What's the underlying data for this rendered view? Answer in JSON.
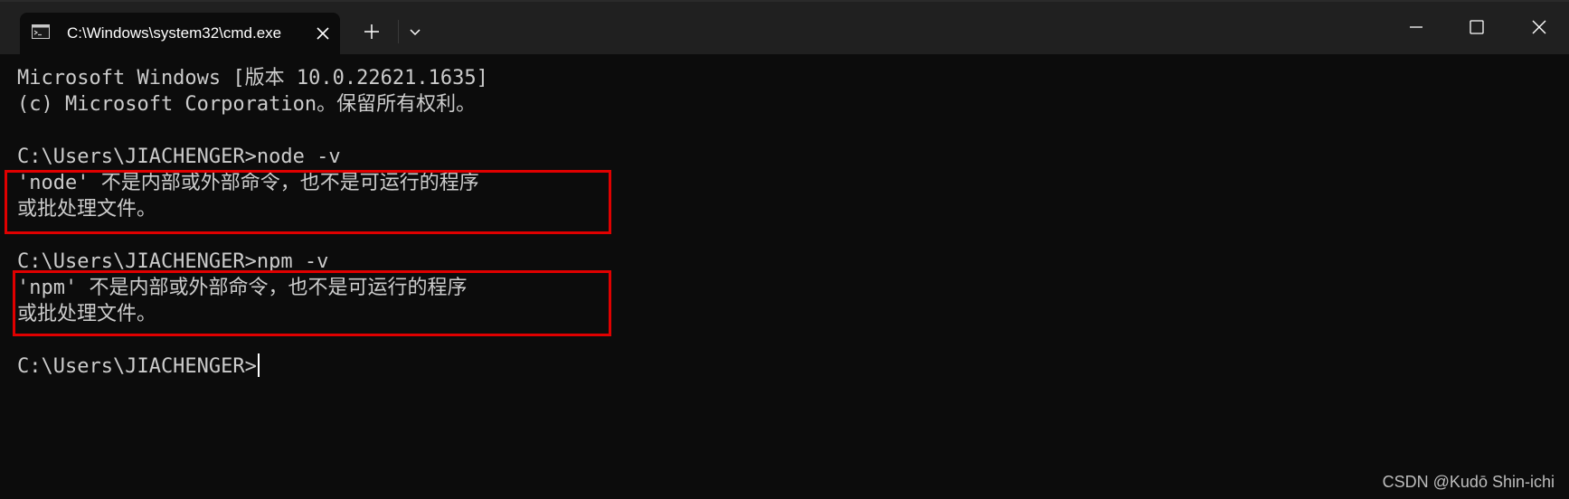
{
  "window": {
    "tab_title": "C:\\Windows\\system32\\cmd.exe",
    "tab_icon": "cmd-terminal-icon",
    "new_tab_icon": "plus-icon",
    "dropdown_icon": "chevron-down-icon",
    "controls": {
      "minimize_icon": "minimize-icon",
      "maximize_icon": "maximize-icon",
      "close_icon": "close-icon"
    }
  },
  "terminal": {
    "lines": [
      "Microsoft Windows [版本 10.0.22621.1635]",
      "(c) Microsoft Corporation。保留所有权利。",
      "",
      "C:\\Users\\JIACHENGER>node -v",
      "'node' 不是内部或外部命令，也不是可运行的程序",
      "或批处理文件。",
      "",
      "C:\\Users\\JIACHENGER>npm -v",
      "'npm' 不是内部或外部命令，也不是可运行的程序",
      "或批处理文件。",
      "",
      "C:\\Users\\JIACHENGER>"
    ],
    "highlight_color": "#e00000",
    "background_color": "#0c0c0c",
    "text_color": "#cccccc"
  },
  "watermark": "CSDN @Kudō Shin-ichi"
}
